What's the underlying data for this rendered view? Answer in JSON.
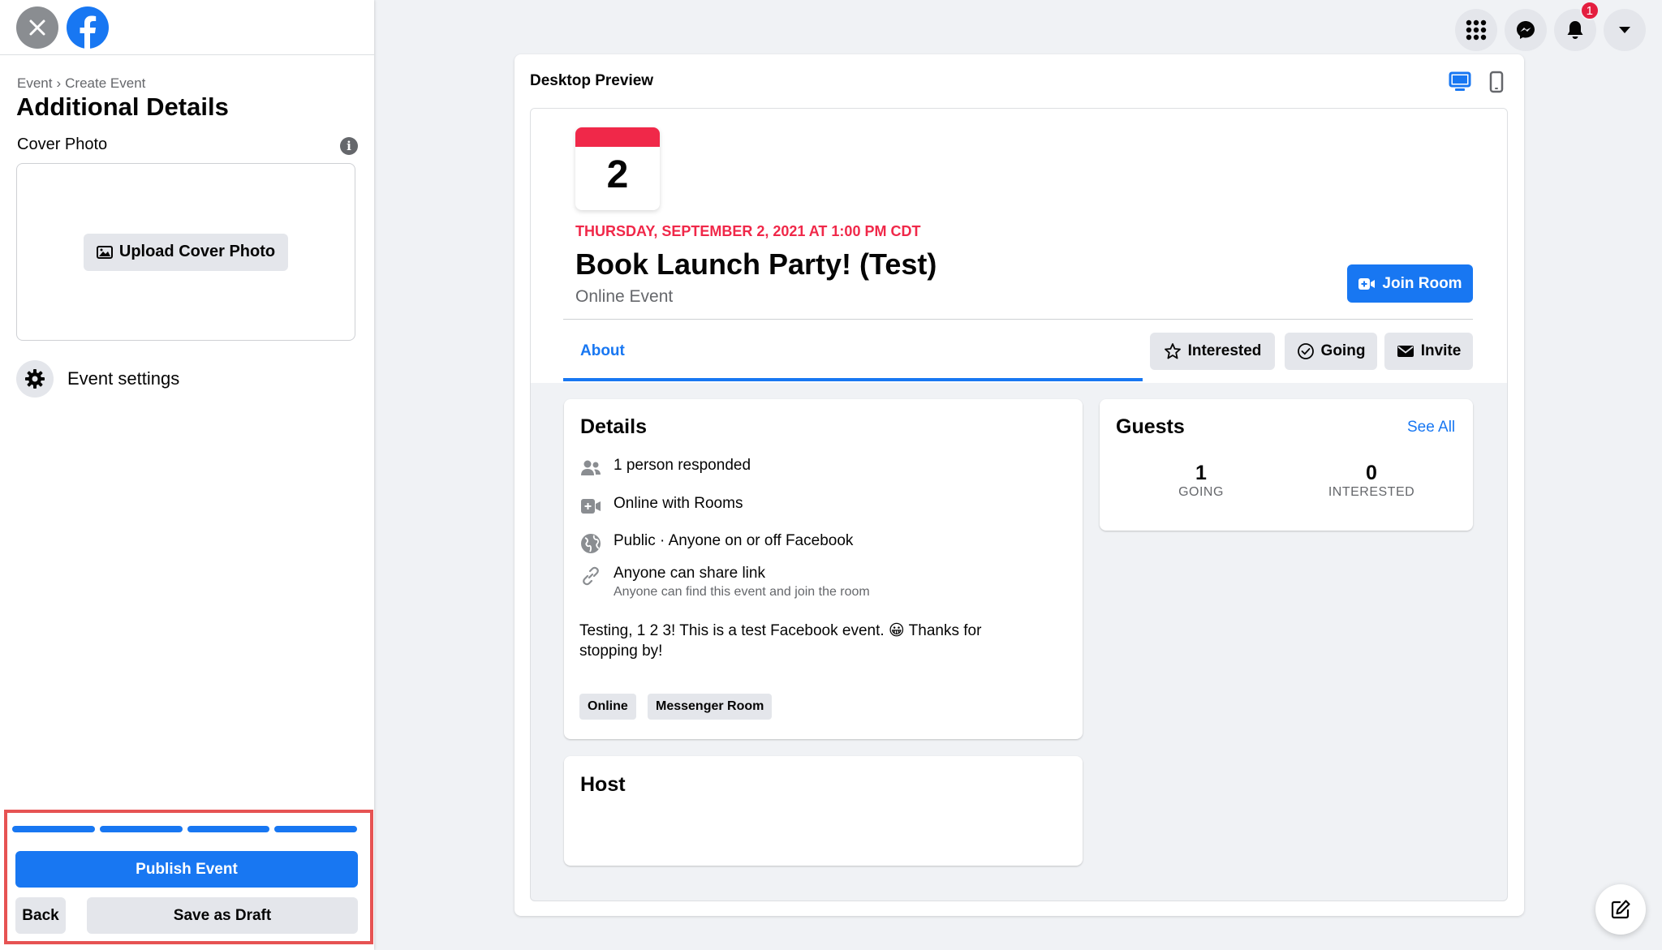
{
  "sidebar": {
    "breadcrumb": {
      "parent": "Event",
      "separator": "›",
      "current": "Create Event"
    },
    "title": "Additional Details",
    "cover_photo_label": "Cover Photo",
    "info_glyph": "i",
    "upload_button": "Upload Cover Photo",
    "event_settings": "Event settings",
    "progress_steps_total": 4,
    "progress_steps_completed": 4,
    "publish_button": "Publish Event",
    "back_button": "Back",
    "draft_button": "Save as Draft"
  },
  "header": {
    "notification_count": "1",
    "icons": [
      "menu-grid-icon",
      "messenger-icon",
      "bell-icon",
      "caret-down-icon"
    ]
  },
  "preview": {
    "label": "Desktop Preview",
    "calendar_day": "2",
    "date_line": "THURSDAY, SEPTEMBER 2, 2021 AT 1:00 PM CDT",
    "event_title": "Book Launch Party! (Test)",
    "event_type": "Online Event",
    "join_button": "Join Room",
    "about_tab": "About",
    "actions": {
      "interested": "Interested",
      "going": "Going",
      "invite": "Invite"
    },
    "details": {
      "title": "Details",
      "responded": "1 person responded",
      "rooms": "Online with Rooms",
      "privacy": "Public · Anyone on or off Facebook",
      "share": "Anyone can share link",
      "share_sub": "Anyone can find this event and join the room",
      "description": "Testing, 1 2 3! This is a test Facebook event. 😀 Thanks for stopping by!",
      "tags": [
        "Online",
        "Messenger Room"
      ]
    },
    "guests": {
      "title": "Guests",
      "see_all": "See All",
      "going_count": "1",
      "going_label": "GOING",
      "interested_count": "0",
      "interested_label": "INTERESTED"
    },
    "host": {
      "title": "Host"
    }
  },
  "colors": {
    "brand_blue": "#1877f2",
    "date_red": "#f02849",
    "highlight_border": "#e65353",
    "background": "#f0f2f5"
  }
}
